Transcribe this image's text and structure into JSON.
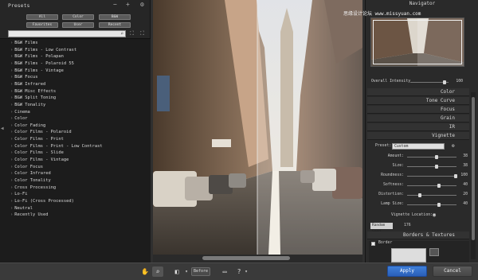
{
  "presets": {
    "title": "Presets",
    "filters": [
      "All",
      "Color",
      "B&W",
      "Favorites",
      "User",
      "Recent"
    ],
    "items": [
      "B&W Films",
      "B&W Films - Low Contrast",
      "B&W Films - Polapan",
      "B&W Films - Polaroid 55",
      "B&W Films - Vintage",
      "B&W Focus",
      "B&W Infrared",
      "B&W Misc Effects",
      "B&W Split Toning",
      "B&W Tonality",
      "Cinema",
      "Color",
      "Color Fading",
      "Color Films - Polaroid",
      "Color Films - Print",
      "Color Films - Print - Low Contrast",
      "Color Films - Slide",
      "Color Films - Vintage",
      "Color Focus",
      "Color Infrared",
      "Color Tonality",
      "Cross Processing",
      "Lo-Fi",
      "Lo-Fi (Cross Processed)",
      "Neutral",
      "Recently Used"
    ]
  },
  "navigator": {
    "title": "Navigator"
  },
  "watermark": "思缘设计论坛 www.missyuan.com",
  "overall_intensity": {
    "label": "Overall Intensity",
    "value": "100",
    "level": 0.9
  },
  "sections": [
    "Color",
    "Tone Curve",
    "Focus",
    "Grain",
    "IR",
    "Vignette",
    "Borders & Textures"
  ],
  "vignette": {
    "preset_label": "Preset:",
    "preset_value": "Custom",
    "sliders": [
      {
        "label": "Amount:",
        "value": "38",
        "level": 0.6
      },
      {
        "label": "Size:",
        "value": "38",
        "level": 0.6
      },
      {
        "label": "Roundness:",
        "value": "100",
        "level": 0.98
      },
      {
        "label": "Softness:",
        "value": "40",
        "level": 0.65
      },
      {
        "label": "Distortion:",
        "value": "20",
        "level": 0.25
      },
      {
        "label": "Lamp Size:",
        "value": "40",
        "level": 0.65
      }
    ],
    "location_label": "Vignette Location:",
    "random_seed_label": "Random Seed",
    "random_seed_value": "176"
  },
  "borders": {
    "checkbox_label": "Border"
  },
  "bottom": {
    "before_label": "Before",
    "apply_label": "Apply",
    "cancel_label": "Cancel"
  }
}
